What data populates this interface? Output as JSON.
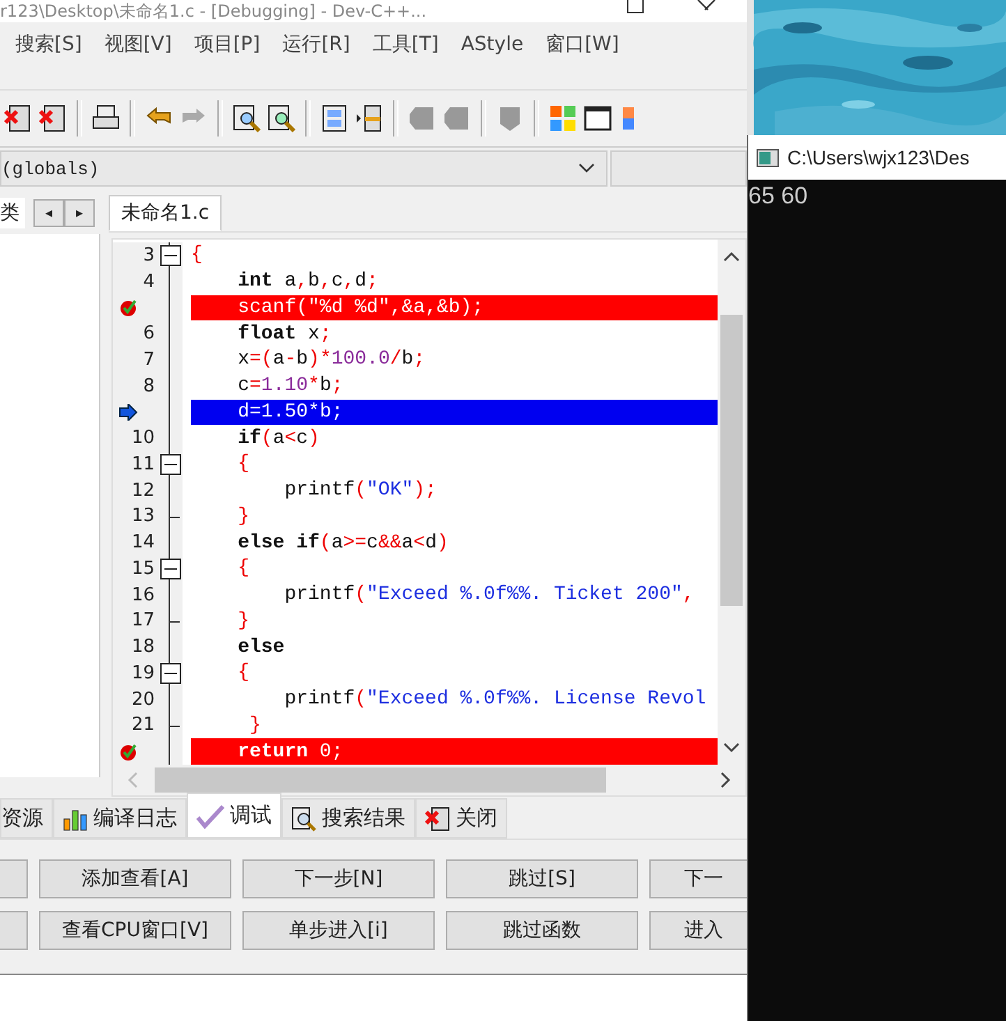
{
  "window": {
    "title": "r123\\Desktop\\未命名1.c - [Debugging] - Dev-C++..."
  },
  "menu": [
    "搜索[S]",
    "视图[V]",
    "项目[P]",
    "运行[R]",
    "工具[T]",
    "AStyle",
    "窗口[W]"
  ],
  "scope_selector": {
    "value": "(globals)"
  },
  "side_panel": {
    "tab": "类",
    "nav": [
      "◂",
      "▸"
    ]
  },
  "editor_tabs": [
    {
      "label": "未命名1.c",
      "selected": true
    }
  ],
  "code_lines": [
    {
      "number": "3",
      "collapsible": true,
      "tokens": [
        {
          "kind": "symbol",
          "text": "{"
        }
      ]
    },
    {
      "number": "4",
      "tokens": [
        {
          "kind": "keyword",
          "text": "    int"
        },
        {
          "kind": "name",
          "text": " a"
        },
        {
          "kind": "symbol",
          "text": ","
        },
        {
          "kind": "name",
          "text": "b"
        },
        {
          "kind": "symbol",
          "text": ","
        },
        {
          "kind": "name",
          "text": "c"
        },
        {
          "kind": "symbol",
          "text": ","
        },
        {
          "kind": "name",
          "text": "d"
        },
        {
          "kind": "symbol",
          "text": ";"
        }
      ]
    },
    {
      "breakpoint": true,
      "tokens": [
        {
          "kind": "name",
          "text": "    scanf"
        },
        {
          "kind": "symbol",
          "text": "("
        },
        {
          "kind": "string",
          "text": "\"%d %d\""
        },
        {
          "kind": "symbol",
          "text": ","
        },
        {
          "kind": "name",
          "text": "&a"
        },
        {
          "kind": "symbol",
          "text": ","
        },
        {
          "kind": "name",
          "text": "&b"
        },
        {
          "kind": "symbol",
          "text": ");"
        }
      ]
    },
    {
      "number": "6",
      "tokens": [
        {
          "kind": "keyword",
          "text": "    float"
        },
        {
          "kind": "name",
          "text": " x"
        },
        {
          "kind": "symbol",
          "text": ";"
        }
      ]
    },
    {
      "number": "7",
      "tokens": [
        {
          "kind": "name",
          "text": "    x"
        },
        {
          "kind": "symbol",
          "text": "=("
        },
        {
          "kind": "name",
          "text": "a"
        },
        {
          "kind": "symbol",
          "text": "-"
        },
        {
          "kind": "name",
          "text": "b"
        },
        {
          "kind": "symbol",
          "text": ")*"
        },
        {
          "kind": "number",
          "text": "100.0"
        },
        {
          "kind": "symbol",
          "text": "/"
        },
        {
          "kind": "name",
          "text": "b"
        },
        {
          "kind": "symbol",
          "text": ";"
        }
      ]
    },
    {
      "number": "8",
      "tokens": [
        {
          "kind": "name",
          "text": "    c"
        },
        {
          "kind": "symbol",
          "text": "="
        },
        {
          "kind": "number",
          "text": "1.10"
        },
        {
          "kind": "symbol",
          "text": "*"
        },
        {
          "kind": "name",
          "text": "b"
        },
        {
          "kind": "symbol",
          "text": ";"
        }
      ]
    },
    {
      "current": true,
      "tokens": [
        {
          "kind": "name",
          "text": "    d"
        },
        {
          "kind": "symbol",
          "text": "="
        },
        {
          "kind": "number",
          "text": "1.50"
        },
        {
          "kind": "symbol",
          "text": "*"
        },
        {
          "kind": "name",
          "text": "b"
        },
        {
          "kind": "symbol",
          "text": ";"
        }
      ]
    },
    {
      "number": "10",
      "tokens": [
        {
          "kind": "keyword",
          "text": "    if"
        },
        {
          "kind": "symbol",
          "text": "("
        },
        {
          "kind": "name",
          "text": "a"
        },
        {
          "kind": "symbol",
          "text": "<"
        },
        {
          "kind": "name",
          "text": "c"
        },
        {
          "kind": "symbol",
          "text": ")"
        }
      ]
    },
    {
      "number": "11",
      "collapsible": true,
      "tokens": [
        {
          "kind": "symbol",
          "text": "    {"
        }
      ]
    },
    {
      "number": "12",
      "tokens": [
        {
          "kind": "name",
          "text": "        printf"
        },
        {
          "kind": "symbol",
          "text": "("
        },
        {
          "kind": "string",
          "text": "\"OK\""
        },
        {
          "kind": "symbol",
          "text": ");"
        }
      ]
    },
    {
      "number": "13",
      "block_end": true,
      "tokens": [
        {
          "kind": "symbol",
          "text": "    }"
        }
      ]
    },
    {
      "number": "14",
      "tokens": [
        {
          "kind": "keyword",
          "text": "    else if"
        },
        {
          "kind": "symbol",
          "text": "("
        },
        {
          "kind": "name",
          "text": "a"
        },
        {
          "kind": "symbol",
          "text": ">="
        },
        {
          "kind": "name",
          "text": "c"
        },
        {
          "kind": "symbol",
          "text": "&&"
        },
        {
          "kind": "name",
          "text": "a"
        },
        {
          "kind": "symbol",
          "text": "<"
        },
        {
          "kind": "name",
          "text": "d"
        },
        {
          "kind": "symbol",
          "text": ")"
        }
      ]
    },
    {
      "number": "15",
      "collapsible": true,
      "tokens": [
        {
          "kind": "symbol",
          "text": "    {"
        }
      ]
    },
    {
      "number": "16",
      "tokens": [
        {
          "kind": "name",
          "text": "        printf"
        },
        {
          "kind": "symbol",
          "text": "("
        },
        {
          "kind": "string",
          "text": "\"Exceed %.0f%%. Ticket 200\""
        },
        {
          "kind": "symbol",
          "text": ","
        }
      ]
    },
    {
      "number": "17",
      "block_end": true,
      "tokens": [
        {
          "kind": "symbol",
          "text": "    }"
        }
      ]
    },
    {
      "number": "18",
      "tokens": [
        {
          "kind": "keyword",
          "text": "    else"
        }
      ]
    },
    {
      "number": "19",
      "collapsible": true,
      "tokens": [
        {
          "kind": "symbol",
          "text": "    {"
        }
      ]
    },
    {
      "number": "20",
      "tokens": [
        {
          "kind": "name",
          "text": "        printf"
        },
        {
          "kind": "symbol",
          "text": "("
        },
        {
          "kind": "string",
          "text": "\"Exceed %.0f%%. License Revol"
        }
      ]
    },
    {
      "number": "21",
      "block_end": true,
      "tokens": [
        {
          "kind": "symbol",
          "text": "     }"
        }
      ]
    },
    {
      "breakpoint": true,
      "tokens": [
        {
          "kind": "keyword",
          "text": "    return"
        },
        {
          "kind": "number",
          "text": " 0"
        },
        {
          "kind": "symbol",
          "text": ";"
        }
      ]
    }
  ],
  "bottom_tabs": [
    {
      "label": "资源",
      "kind": "plain",
      "selected": false
    },
    {
      "label": "编译日志",
      "kind": "log",
      "selected": false
    },
    {
      "label": "调试",
      "kind": "debug",
      "selected": true
    },
    {
      "label": "搜索结果",
      "kind": "search",
      "selected": false
    },
    {
      "label": "关闭",
      "kind": "close",
      "selected": false
    }
  ],
  "debug_buttons": [
    [
      {
        "kind": "blank"
      },
      {
        "kind": "button",
        "label": "添加查看[A]"
      },
      {
        "kind": "button",
        "label": "下一步[N]"
      },
      {
        "kind": "button",
        "label": "跳过[S]"
      },
      {
        "kind": "button",
        "label": "下一"
      }
    ],
    [
      {
        "kind": "blank"
      },
      {
        "kind": "button",
        "label": "查看CPU窗口[V]"
      },
      {
        "kind": "button",
        "label": "单步进入[i]"
      },
      {
        "kind": "button",
        "label": "跳过函数"
      },
      {
        "kind": "button",
        "label": "进入"
      }
    ]
  ],
  "console": {
    "title": "C:\\Users\\wjx123\\Des",
    "output": "65 60"
  }
}
